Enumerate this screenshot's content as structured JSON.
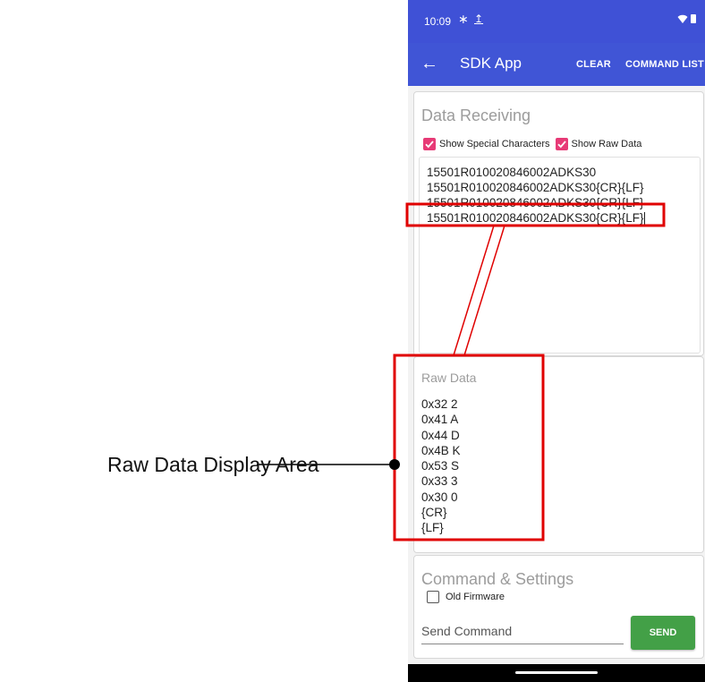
{
  "status_bar": {
    "time": "10:09",
    "bluetooth_glyph": "∗",
    "upload_glyph": "↥",
    "icons": [
      "wifi-icon",
      "battery-icon"
    ]
  },
  "toolbar": {
    "back_glyph": "←",
    "title": "SDK App",
    "clear_label": "CLEAR",
    "command_list_label": "COMMAND LIST",
    "color": "#4055d6"
  },
  "data_receiving": {
    "title": "Data Receiving",
    "show_special_label": "Show Special Characters",
    "show_special_checked": true,
    "show_raw_label": "Show Raw Data",
    "show_raw_checked": true,
    "lines": [
      "15501R010020846002ADKS30",
      "15501R010020846002ADKS30{CR}{LF}",
      "15501R010020846002ADKS30{CR}{LF}",
      "15501R010020846002ADKS30{CR}{LF}"
    ]
  },
  "raw_data": {
    "title": "Raw Data",
    "lines": [
      "0x32 2",
      "0x41 A",
      "0x44 D",
      "0x4B K",
      "0x53 S",
      "0x33 3",
      "0x30 0",
      "{CR}",
      "{LF}"
    ]
  },
  "command_settings": {
    "title": "Command & Settings",
    "old_firmware_label": "Old Firmware",
    "old_firmware_checked": false,
    "send_placeholder": "Send Command",
    "send_label": "SEND",
    "send_color": "#43a047"
  },
  "annotation": {
    "callout_label": "Raw Data Display Area",
    "highlight_color": "#e00000"
  }
}
